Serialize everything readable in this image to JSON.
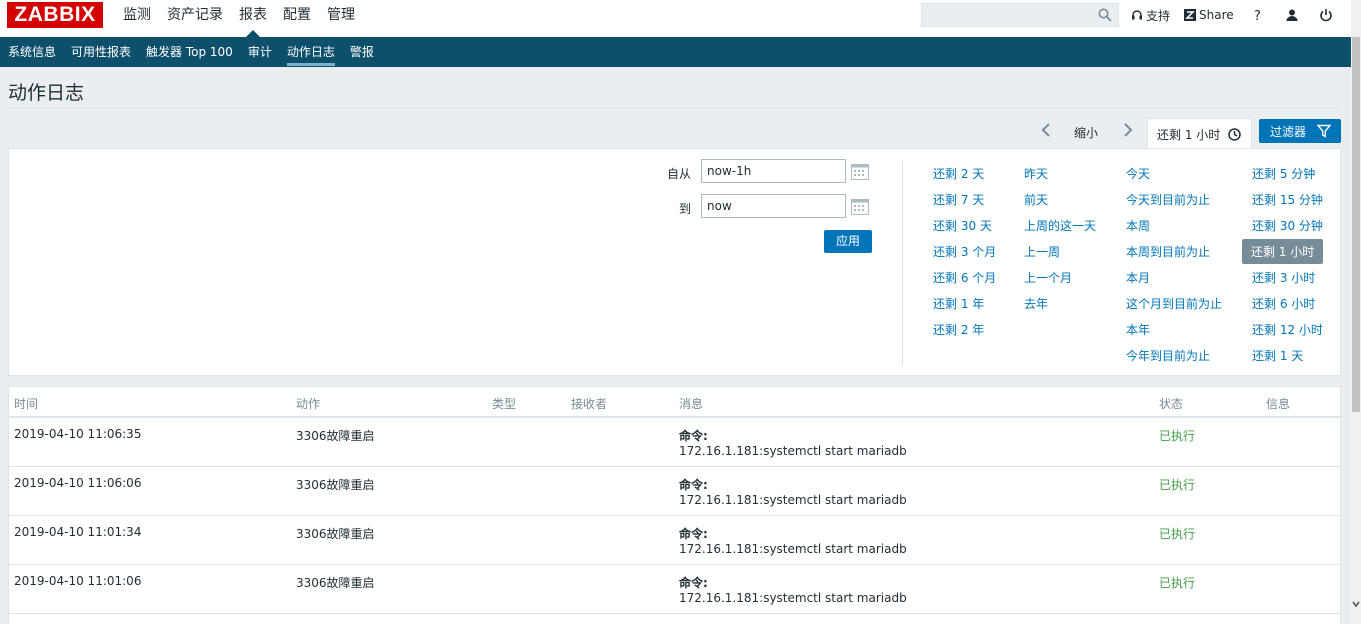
{
  "logo": "ZABBIX",
  "main_menu": [
    {
      "label": "监测"
    },
    {
      "label": "资产记录"
    },
    {
      "label": "报表"
    },
    {
      "label": "配置"
    },
    {
      "label": "管理"
    }
  ],
  "search": {
    "value": "",
    "placeholder": ""
  },
  "top_links": {
    "support": "支持",
    "share": "Share"
  },
  "sub_menu": [
    {
      "label": "系统信息"
    },
    {
      "label": "可用性报表"
    },
    {
      "label": "触发器 Top 100"
    },
    {
      "label": "审计"
    },
    {
      "label": "动作日志"
    },
    {
      "label": "警报"
    }
  ],
  "page_title": "动作日志",
  "time_nav": {
    "zoom_out": "缩小",
    "current_range": "还剩 1 小时",
    "filter": "过滤器"
  },
  "filter": {
    "from_label": "自从",
    "from_value": "now-1h",
    "to_label": "到",
    "to_value": "now",
    "apply": "应用"
  },
  "quick_ranges": {
    "col1": [
      "还剩 2 天",
      "还剩 7 天",
      "还剩 30 天",
      "还剩 3 个月",
      "还剩 6 个月",
      "还剩 1 年",
      "还剩 2 年"
    ],
    "col2": [
      "昨天",
      "前天",
      "上周的这一天",
      "上一周",
      "上一个月",
      "去年"
    ],
    "col3": [
      "今天",
      "今天到目前为止",
      "本周",
      "本周到目前为止",
      "本月",
      "这个月到目前为止",
      "本年",
      "今年到目前为止"
    ],
    "col4": [
      "还剩 5 分钟",
      "还剩 15 分钟",
      "还剩 30 分钟",
      "还剩 1 小时",
      "还剩 3 小时",
      "还剩 6 小时",
      "还剩 12 小时",
      "还剩 1 天"
    ]
  },
  "table": {
    "headers": [
      "时间",
      "动作",
      "类型",
      "接收者",
      "消息",
      "状态",
      "信息"
    ],
    "rows": [
      {
        "time": "2019-04-10 11:06:35",
        "action": "3306故障重启",
        "msg_title": "命令:",
        "msg_body": "172.16.1.181:systemctl start mariadb",
        "status": "已执行"
      },
      {
        "time": "2019-04-10 11:06:06",
        "action": "3306故障重启",
        "msg_title": "命令:",
        "msg_body": "172.16.1.181:systemctl start mariadb",
        "status": "已执行"
      },
      {
        "time": "2019-04-10 11:01:34",
        "action": "3306故障重启",
        "msg_title": "命令:",
        "msg_body": "172.16.1.181:systemctl start mariadb",
        "status": "已执行"
      },
      {
        "time": "2019-04-10 11:01:06",
        "action": "3306故障重启",
        "msg_title": "命令:",
        "msg_body": "172.16.1.181:systemctl start mariadb",
        "status": "已执行"
      }
    ]
  },
  "colors": {
    "brand": "#d40000",
    "nav": "#0e4f6b",
    "link": "#0275b8",
    "success": "#429e47"
  }
}
